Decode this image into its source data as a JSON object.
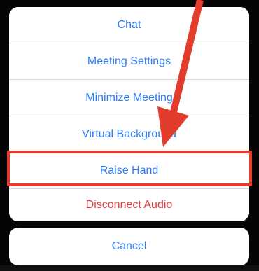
{
  "action_sheet": {
    "items": [
      {
        "label": "Chat",
        "style": "default"
      },
      {
        "label": "Meeting Settings",
        "style": "default"
      },
      {
        "label": "Minimize Meeting",
        "style": "default"
      },
      {
        "label": "Virtual Background",
        "style": "default"
      },
      {
        "label": "Raise Hand",
        "style": "default"
      },
      {
        "label": "Disconnect Audio",
        "style": "destructive"
      }
    ],
    "cancel_label": "Cancel"
  },
  "colors": {
    "action_blue": "#2d7cf6",
    "destructive_red": "#e23b3b",
    "annotation_red": "#e23c2d"
  }
}
